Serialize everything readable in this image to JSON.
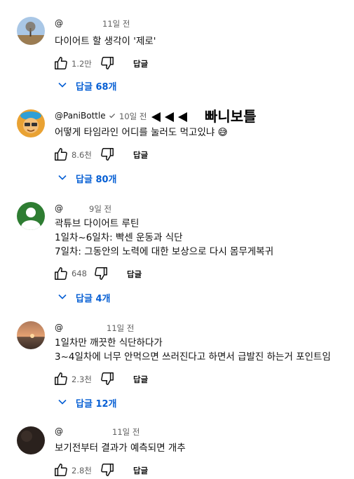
{
  "comments": [
    {
      "handle": "@",
      "date": "11일 전",
      "lines": [
        "다이어트 할 생각이 '제로'"
      ],
      "likes": "1.2만",
      "reply_label": "답글",
      "replies_label": "답글 68개",
      "avatar": "landscape-tree"
    },
    {
      "handle": "@PaniBottle",
      "date": "10일 전",
      "lines": [
        "어떻게 타임라인 어디를 눌러도 먹고있냐 😅"
      ],
      "likes": "8.6천",
      "reply_label": "답글",
      "replies_label": "답글 80개",
      "avatar": "cartoon-face",
      "annotation": "빠니보틀",
      "verified": true
    },
    {
      "handle": "@",
      "date": "9일 전",
      "lines": [
        "곽튜브 다이어트 루틴",
        "1일차~6일차: 빡센 운동과 식단",
        "7일차: 그동안의 노력에 대한 보상으로 다시 몸무게복귀"
      ],
      "likes": "648",
      "reply_label": "답글",
      "replies_label": "답글 4개",
      "avatar": "default-green"
    },
    {
      "handle": "@",
      "date": "11일 전",
      "lines": [
        "1일차만 깨끗한 식단하다가",
        "3~4일차에 너무 안먹으면 쓰러진다고 하면서 급발진 하는거 포인트임"
      ],
      "likes": "2.3천",
      "reply_label": "답글",
      "replies_label": "답글 12개",
      "avatar": "sunset"
    },
    {
      "handle": "@",
      "date": "11일 전",
      "lines": [
        "보기전부터 결과가 예측되면 개추"
      ],
      "likes": "2.8천",
      "reply_label": "답글",
      "avatar": "dark"
    }
  ],
  "colors": {
    "link_blue": "#065fd4",
    "muted_gray": "#606060",
    "avatar_green": "#2e7d32"
  }
}
